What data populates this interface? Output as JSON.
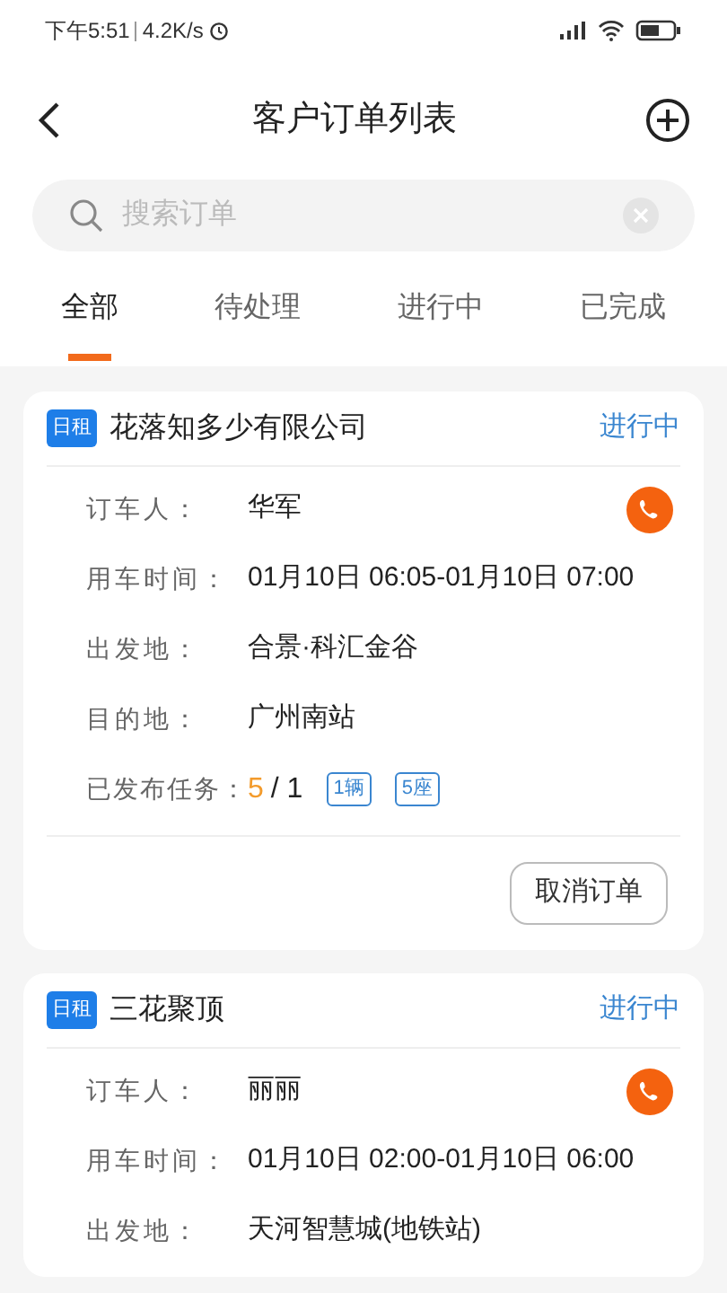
{
  "status_bar": {
    "time": "下午5:51",
    "speed": "4.2K/s"
  },
  "header": {
    "title": "客户订单列表"
  },
  "search": {
    "placeholder": "搜索订单"
  },
  "tabs": [
    {
      "label": "全部",
      "selected": true
    },
    {
      "label": "待处理",
      "selected": false
    },
    {
      "label": "进行中",
      "selected": false
    },
    {
      "label": "已完成",
      "selected": false
    }
  ],
  "orders": [
    {
      "tag": "日租",
      "company": "花落知多少有限公司",
      "status": "进行中",
      "fields": [
        {
          "label": "订车人：",
          "value": "华军",
          "kind": "contact"
        },
        {
          "label": "用车时间：",
          "value": "01月10日 06:05-01月10日 07:00",
          "kind": "text"
        },
        {
          "label": "出发地：",
          "value": "合景·科汇金谷",
          "kind": "text"
        },
        {
          "label": "目的地：",
          "value": "广州南站",
          "kind": "text"
        }
      ],
      "tasks": {
        "label": "已发布任务：",
        "done": "5",
        "total": "/ 1",
        "chips": [
          "1辆",
          "5座"
        ]
      },
      "action": "取消订单"
    },
    {
      "tag": "日租",
      "company": "三花聚顶",
      "status": "进行中",
      "fields": [
        {
          "label": "订车人：",
          "value": "丽丽",
          "kind": "contact"
        },
        {
          "label": "用车时间：",
          "value": "01月10日 02:00-01月10日 06:00",
          "kind": "text"
        },
        {
          "label": "出发地：",
          "value": "天河智慧城(地铁站)",
          "kind": "text"
        }
      ]
    }
  ]
}
